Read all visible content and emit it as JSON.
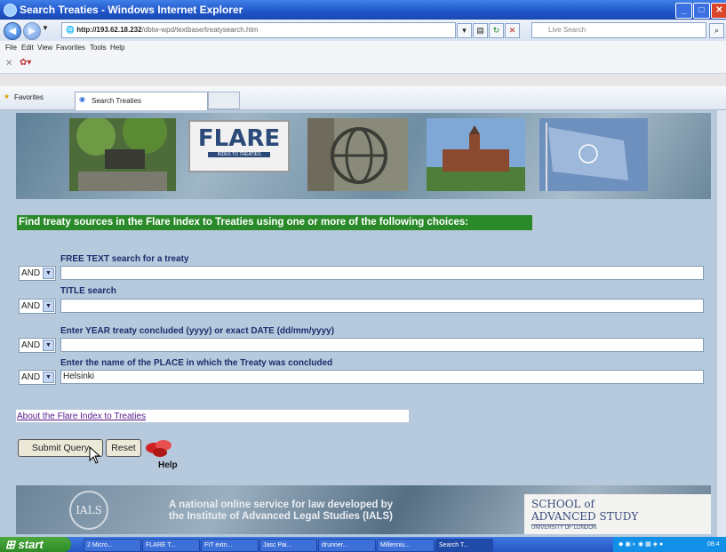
{
  "window": {
    "title": "Search Treaties - Windows Internet Explorer"
  },
  "address": {
    "url_host": "http://193.62.18.232",
    "url_path": "/dbtw-wpd/textbase/treatysearch.htm",
    "search_placeholder": "Live Search"
  },
  "menu": [
    "File",
    "Edit",
    "View",
    "Favorites",
    "Tools",
    "Help"
  ],
  "favorites": {
    "label": "Favorites",
    "tab_title": "Search Treaties"
  },
  "banner": {
    "logo_text": "FLARE",
    "logo_subtitle": "INDEX TO TREATIES"
  },
  "form": {
    "heading": "Find treaty sources in the Flare Index to Treaties using one or more of the following choices:",
    "fields": [
      {
        "label": "FREE TEXT search for a treaty",
        "operator": "AND",
        "value": ""
      },
      {
        "label": "TITLE search",
        "operator": "AND",
        "value": ""
      },
      {
        "label": "Enter YEAR treaty concluded (yyyy) or exact DATE (dd/mm/yyyy)",
        "operator": "AND",
        "value": ""
      },
      {
        "label": "Enter the name of the PLACE in which the Treaty was concluded",
        "operator": "AND",
        "value": "Helsinki"
      }
    ],
    "about_link": "About the Flare Index to Treaties",
    "submit_label": "Submit Query",
    "reset_label": "Reset",
    "help_label": "Help"
  },
  "footer": {
    "text_line1": "A national online service for law developed by",
    "text_line2": "the Institute of Advanced Legal Studies (IALS)",
    "ials_logo": "IALS",
    "sas_line1": "SCHOOL of",
    "sas_line2": "ADVANCED STUDY",
    "sas_line3": "UNIVERSITY OF LONDON"
  },
  "taskbar": {
    "start_label": "start",
    "items": [
      "2 Micro...",
      "FLARE T...",
      "FIT extn...",
      "Jasc Pai...",
      "drunner...",
      "Millenniu...",
      "Search T..."
    ],
    "clock": "08:4"
  }
}
